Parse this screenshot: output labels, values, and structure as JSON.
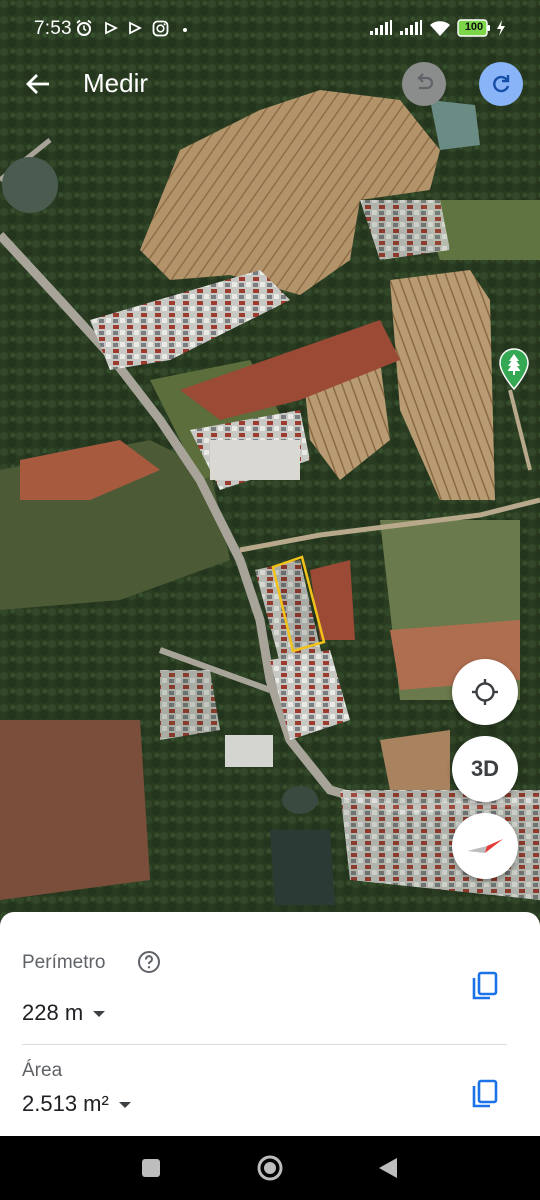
{
  "status_bar": {
    "time": "7:53",
    "battery": "100",
    "icons": [
      "alarm-icon",
      "play-icon",
      "play-icon",
      "instagram-icon",
      "signal-icon",
      "signal-icon",
      "wifi-icon",
      "battery-icon",
      "charging-icon"
    ]
  },
  "app_bar": {
    "title": "Medir",
    "back_icon": "arrow-back-icon",
    "undo_icon": "undo-icon",
    "redo_icon": "redo-icon"
  },
  "map_controls": {
    "locate_icon": "my-location-icon",
    "three_d_label": "3D",
    "compass_icon": "compass-icon",
    "pin_icon": "tree-pin-icon"
  },
  "colors": {
    "selection_outline": "#f2c21b",
    "accent_blue": "#1a73e8",
    "redo_bg": "#8ab4f8",
    "undo_bg": "#8b8d8c"
  },
  "measurement": {
    "perimeter_label": "Perímetro",
    "perimeter_value": "228 m",
    "area_label": "Área",
    "area_value": "2.513 m²",
    "help_icon": "help-icon",
    "copy_icon": "copy-icon"
  },
  "nav_bar": {
    "icons": [
      "recents-icon",
      "home-icon",
      "back-icon"
    ]
  }
}
